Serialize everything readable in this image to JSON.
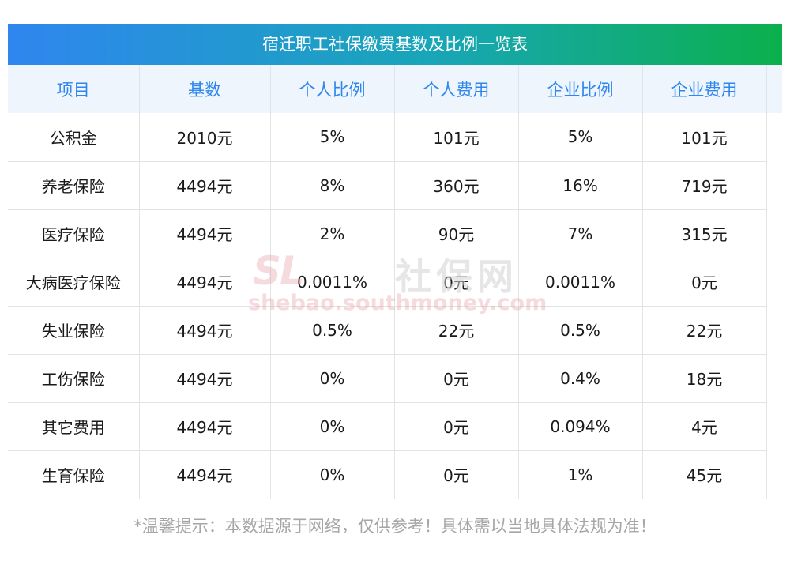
{
  "title": "宿迁职工社保缴费基数及比例一览表",
  "table": {
    "headers": [
      "项目",
      "基数",
      "个人比例",
      "个人费用",
      "企业比例",
      "企业费用"
    ],
    "rows": [
      [
        "公积金",
        "2010元",
        "5%",
        "101元",
        "5%",
        "101元"
      ],
      [
        "养老保险",
        "4494元",
        "8%",
        "360元",
        "16%",
        "719元"
      ],
      [
        "医疗保险",
        "4494元",
        "2%",
        "90元",
        "7%",
        "315元"
      ],
      [
        "大病医疗保险",
        "4494元",
        "0.0011%",
        "0元",
        "0.0011%",
        "0元"
      ],
      [
        "失业保险",
        "4494元",
        "0.5%",
        "22元",
        "0.5%",
        "22元"
      ],
      [
        "工伤保险",
        "4494元",
        "0%",
        "0元",
        "0.4%",
        "18元"
      ],
      [
        "其它费用",
        "4494元",
        "0%",
        "0元",
        "0.094%",
        "4元"
      ],
      [
        "生育保险",
        "4494元",
        "0%",
        "0元",
        "1%",
        "45元"
      ]
    ]
  },
  "watermark": {
    "logo_text": "SL",
    "name": "社保网",
    "url": "shebao.southmoney.com"
  },
  "footnote": "*温馨提示：本数据源于网络，仅供参考！具体需以当地具体法规为准！",
  "colors": {
    "title_gradient_start": "#2f86ef",
    "title_gradient_end": "#0bb04c",
    "header_text": "#2f86ef",
    "header_bg": "#eef5fd"
  }
}
